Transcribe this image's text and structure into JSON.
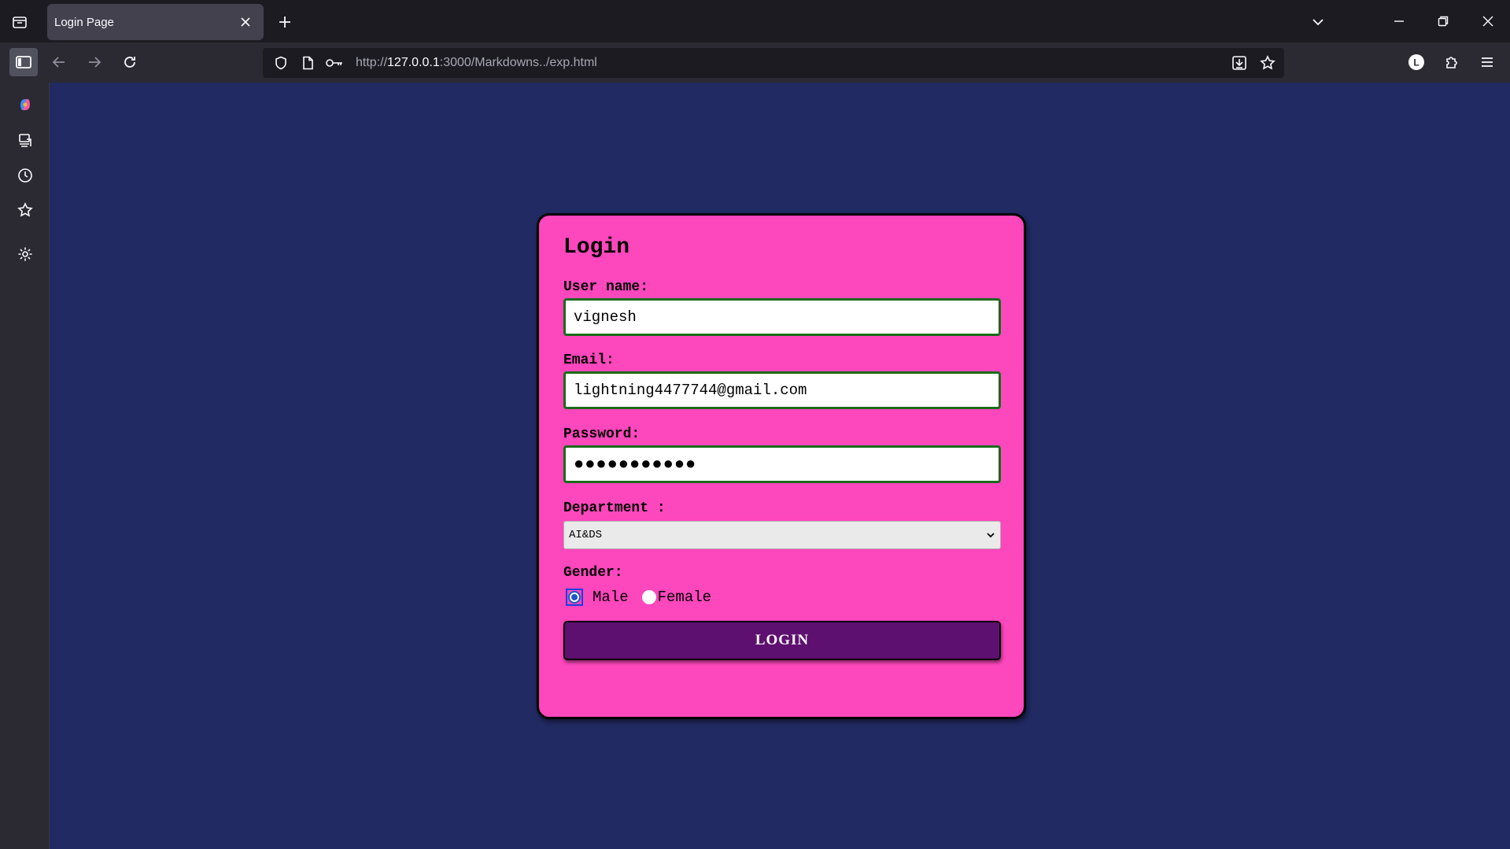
{
  "browser": {
    "tab": {
      "title": "Login Page"
    },
    "url": {
      "prefix": "http://",
      "host": "127.0.0.1",
      "path": ":3000/Markdowns../exp.html"
    },
    "profile_initial": "L"
  },
  "form": {
    "title": "Login",
    "username_label": "User name:",
    "username_value": "vignesh",
    "email_label": "Email:",
    "email_value": "lightning4477744@gmail.com",
    "password_label": "Password:",
    "password_masked": "●●●●●●●●●●●",
    "department_label": "Department :",
    "department_value": "AI&DS",
    "gender_label": "Gender:",
    "gender_options": [
      "Male",
      "Female"
    ],
    "gender_selected": "Male",
    "submit_label": "LOGIN"
  },
  "colors": {
    "page_bg": "#212a62",
    "card_bg": "#fd47bd",
    "input_border": "#1a6b1a",
    "button_bg": "#5e1070"
  }
}
